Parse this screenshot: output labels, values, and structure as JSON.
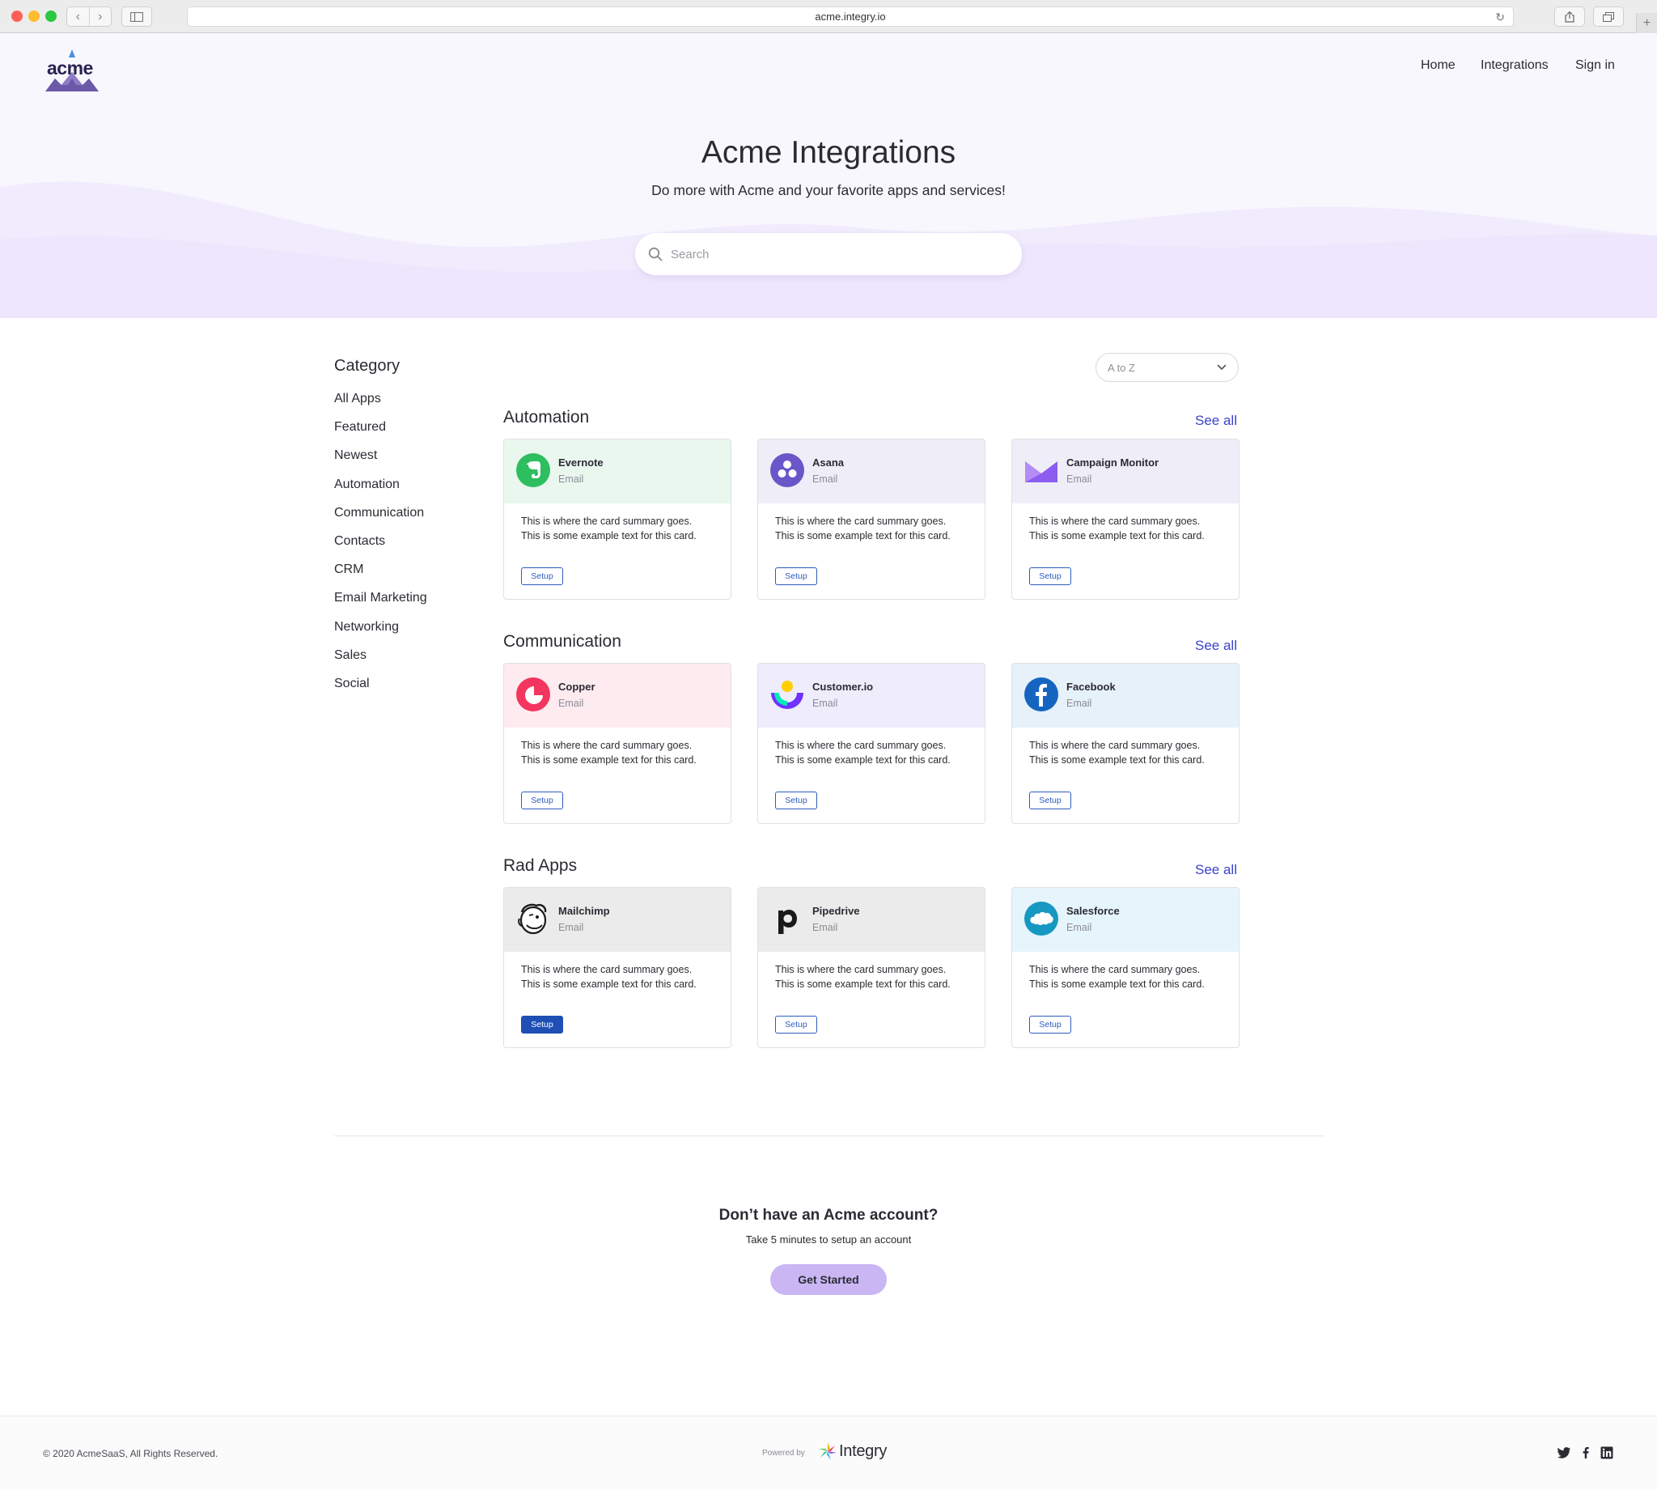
{
  "browser": {
    "url": "acme.integry.io"
  },
  "brand": {
    "logo_text": "acme",
    "accent": "#3a43c9",
    "button_blue": "#2d5bbf",
    "cta_purple": "#c9b6f3"
  },
  "nav": {
    "home": "Home",
    "integrations": "Integrations",
    "sign_in": "Sign in"
  },
  "hero": {
    "title": "Acme Integrations",
    "subtitle": "Do more with Acme and your favorite apps and services!",
    "search_placeholder": "Search"
  },
  "sidebar": {
    "title": "Category",
    "items": [
      {
        "label": "All Apps"
      },
      {
        "label": "Featured"
      },
      {
        "label": "Newest"
      },
      {
        "label": "Automation"
      },
      {
        "label": "Communication"
      },
      {
        "label": "Contacts"
      },
      {
        "label": "CRM"
      },
      {
        "label": "Email Marketing"
      },
      {
        "label": "Networking"
      },
      {
        "label": "Sales"
      },
      {
        "label": "Social"
      }
    ]
  },
  "sort": {
    "selected": "A to Z"
  },
  "sections": [
    {
      "title": "Automation",
      "see_all": "See all",
      "cards": [
        {
          "name": "Evernote",
          "sub": "Email",
          "summary": "This is where the card summary goes. This is some example text for this card.",
          "button": "Setup",
          "icon": "evernote-logo",
          "head_color": "#e9f7ef"
        },
        {
          "name": "Asana",
          "sub": "Email",
          "summary": "This is where the card summary goes. This is some example text for this card.",
          "button": "Setup",
          "icon": "asana-logo",
          "head_color": "#efeef8"
        },
        {
          "name": "Campaign Monitor",
          "sub": "Email",
          "summary": "This is where the card summary goes. This is some example text for this card.",
          "button": "Setup",
          "icon": "campaign-monitor-logo",
          "head_color": "#efeef8"
        }
      ]
    },
    {
      "title": "Communication",
      "see_all": "See all",
      "cards": [
        {
          "name": "Copper",
          "sub": "Email",
          "summary": "This is where the card summary goes. This is some example text for this card.",
          "button": "Setup",
          "icon": "copper-logo",
          "head_color": "#fdebef"
        },
        {
          "name": "Customer.io",
          "sub": "Email",
          "summary": "This is where the card summary goes. This is some example text for this card.",
          "button": "Setup",
          "icon": "customer-io-logo",
          "head_color": "#efecfb"
        },
        {
          "name": "Facebook",
          "sub": "Email",
          "summary": "This is where the card summary goes. This is some example text for this card.",
          "button": "Setup",
          "icon": "facebook-logo",
          "head_color": "#e6f1fa"
        }
      ]
    },
    {
      "title": "Rad Apps",
      "see_all": "See all",
      "cards": [
        {
          "name": "Mailchimp",
          "sub": "Email",
          "summary": "This is where the card summary goes. This is some example text for this card.",
          "button": "Setup",
          "icon": "mailchimp-logo",
          "head_color": "#ebebeb",
          "active": true
        },
        {
          "name": "Pipedrive",
          "sub": "Email",
          "summary": "This is where the card summary goes. This is some example text for this card.",
          "button": "Setup",
          "icon": "pipedrive-logo",
          "head_color": "#ebebeb"
        },
        {
          "name": "Salesforce",
          "sub": "Email",
          "summary": "This is where the card summary goes. This is some example text for this card.",
          "button": "Setup",
          "icon": "salesforce-logo",
          "head_color": "#e5f5fb"
        }
      ]
    }
  ],
  "cta": {
    "title": "Don’t have an Acme account?",
    "subtitle": "Take 5 minutes to setup an account",
    "button": "Get Started"
  },
  "footer": {
    "copyright": "© 2020 AcmeSaaS, All Rights Reserved.",
    "powered_by": "Powered by",
    "integry": "Integry",
    "social_icons": [
      "twitter-icon",
      "facebook-icon",
      "linkedin-icon"
    ]
  }
}
